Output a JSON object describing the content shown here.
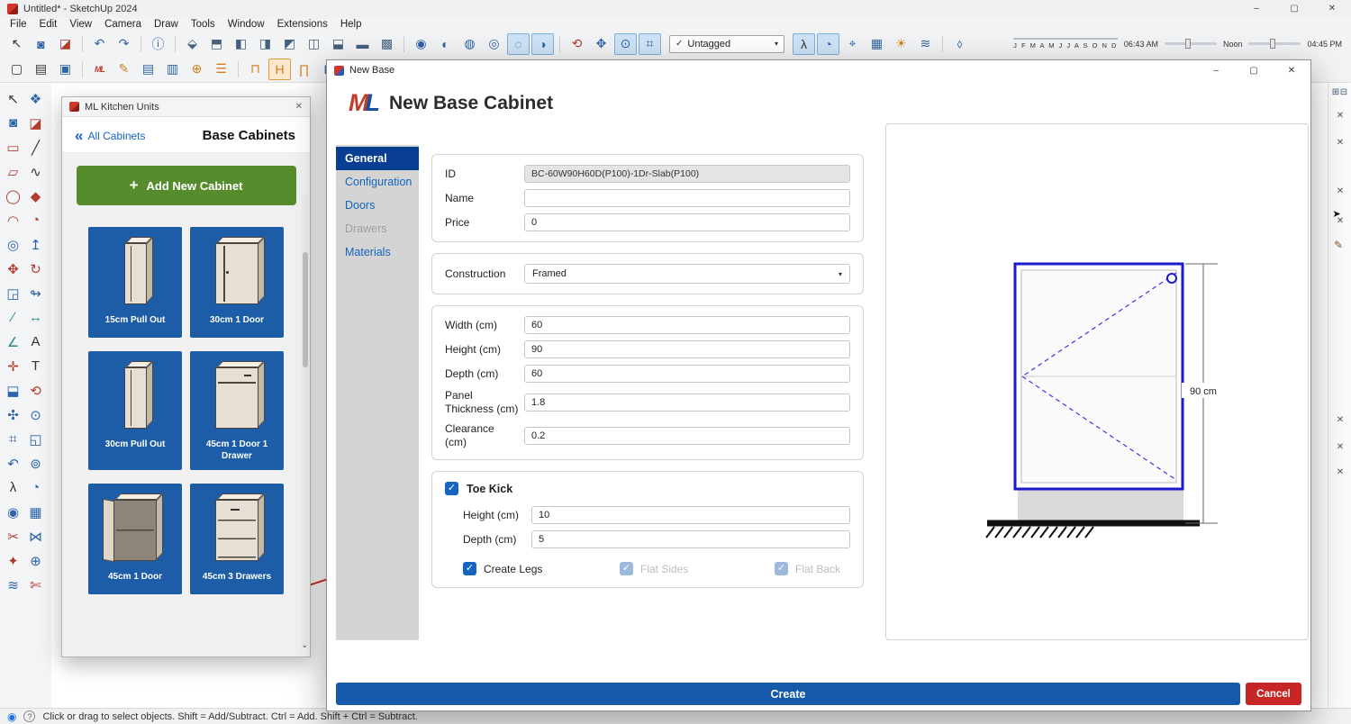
{
  "icons": {
    "close": "✕",
    "minimize": "–",
    "maximize": "▢",
    "caret": "▾",
    "check": "✓",
    "back_chevrons": "«",
    "plus": "+",
    "geo": "◉",
    "help": "?",
    "scroll_down": "⌄",
    "flyout_arrow": "➤",
    "pencil": "✎",
    "tray_expand": "⊞",
    "tray_panels": "⊟"
  },
  "window": {
    "title": "Untitled* - SketchUp 2024"
  },
  "menu": {
    "items": [
      {
        "label": "File",
        "name": "menu-file"
      },
      {
        "label": "Edit",
        "name": "menu-edit"
      },
      {
        "label": "View",
        "name": "menu-view"
      },
      {
        "label": "Camera",
        "name": "menu-camera"
      },
      {
        "label": "Draw",
        "name": "menu-draw"
      },
      {
        "label": "Tools",
        "name": "menu-tools"
      },
      {
        "label": "Window",
        "name": "menu-window"
      },
      {
        "label": "Extensions",
        "name": "menu-extensions"
      },
      {
        "label": "Help",
        "name": "menu-help"
      }
    ]
  },
  "toolbar_top": {
    "row1a": [
      {
        "name": "select-tool-icon",
        "glyph": "↖",
        "cls": "c-dark"
      },
      {
        "name": "paint-bucket-icon",
        "glyph": "◙",
        "cls": "c-blue"
      },
      {
        "name": "eraser-icon",
        "glyph": "◪",
        "cls": "c-red"
      },
      {
        "name": "separator",
        "glyph": "",
        "cls": "sep",
        "inter": "false"
      },
      {
        "name": "undo-icon",
        "glyph": "↶",
        "cls": "c-blue"
      },
      {
        "name": "redo-icon",
        "glyph": "↷",
        "cls": "c-blue"
      },
      {
        "name": "separator",
        "glyph": "",
        "cls": "sep",
        "inter": "false"
      },
      {
        "name": "model-info-icon",
        "glyph": "ⓘ",
        "cls": "c-blue"
      },
      {
        "name": "separator",
        "glyph": "",
        "cls": "sep",
        "inter": "false"
      },
      {
        "name": "iso-view-icon",
        "glyph": "⬙"
      },
      {
        "name": "top-view-icon",
        "glyph": "⬒"
      },
      {
        "name": "front-view-icon",
        "glyph": "◧"
      },
      {
        "name": "right-view-icon",
        "glyph": "◨"
      },
      {
        "name": "back-view-icon",
        "glyph": "◩"
      },
      {
        "name": "left-view-icon",
        "glyph": "◫"
      },
      {
        "name": "section-plane-icon",
        "glyph": "⬓"
      },
      {
        "name": "section-cuts-icon",
        "glyph": "▬"
      },
      {
        "name": "section-fill-icon",
        "glyph": "▩"
      },
      {
        "name": "separator",
        "glyph": "",
        "cls": "sep",
        "inter": "false"
      },
      {
        "name": "outer-shell-icon",
        "glyph": "◉",
        "cls": "c-blue"
      },
      {
        "name": "intersect-icon",
        "glyph": "◐",
        "cls": "c-blue"
      },
      {
        "name": "union-icon",
        "glyph": "◍",
        "cls": "c-blue"
      },
      {
        "name": "subtract-icon",
        "glyph": "◎",
        "cls": "c-blue"
      },
      {
        "name": "trim-icon",
        "glyph": "◌",
        "cls": "c-blue pressed"
      },
      {
        "name": "split-icon",
        "glyph": "◑",
        "cls": "c-blue pressed"
      },
      {
        "name": "separator",
        "glyph": "",
        "cls": "sep",
        "inter": "false"
      },
      {
        "name": "orbit-icon",
        "glyph": "⟲",
        "cls": "c-red"
      },
      {
        "name": "pan-icon",
        "glyph": "✥",
        "cls": "c-blue"
      },
      {
        "name": "zoom-icon",
        "glyph": "⊙",
        "cls": "c-blue pressed"
      },
      {
        "name": "zoom-extents-icon",
        "glyph": "⌗",
        "cls": "c-blue pressed"
      }
    ],
    "tag_filter": {
      "value": "Untagged"
    },
    "row1b": [
      {
        "name": "walk-icon",
        "glyph": "λ",
        "cls": "c-dark pressed"
      },
      {
        "name": "look-around-icon",
        "glyph": "◔",
        "cls": "c-blue pressed"
      },
      {
        "name": "position-camera-icon",
        "glyph": "⌖",
        "cls": "c-blue"
      },
      {
        "name": "match-photo-icon",
        "glyph": "▦",
        "cls": "c-blue"
      },
      {
        "name": "shadows-toggle-icon",
        "glyph": "☀",
        "cls": "c-orange"
      },
      {
        "name": "fog-icon",
        "glyph": "≋",
        "cls": "c-blue"
      },
      {
        "name": "separator",
        "glyph": "",
        "cls": "sep",
        "inter": "false"
      },
      {
        "name": "paint-large-icon",
        "glyph": "⬨",
        "cls": "c-blue"
      }
    ],
    "months": "J F M A M J J A S O N D",
    "time_start": "06:43 AM",
    "time_mid": "Noon",
    "time_end": "04:45 PM",
    "row2": [
      {
        "name": "new-file-icon",
        "glyph": "▢",
        "cls": "c-dark"
      },
      {
        "name": "open-file-icon",
        "glyph": "▤",
        "cls": "c-dark"
      },
      {
        "name": "save-file-icon",
        "glyph": "▣",
        "cls": "c-blue"
      },
      {
        "name": "separator",
        "glyph": "",
        "cls": "sep",
        "inter": "false"
      },
      {
        "name": "ml-kitchen-logo-icon",
        "glyph": "ML",
        "cls": "ml"
      },
      {
        "name": "edit-cabinet-icon",
        "glyph": "✎",
        "cls": "c-orange"
      },
      {
        "name": "cut-list-icon",
        "glyph": "▤",
        "cls": "c-blue"
      },
      {
        "name": "catalog-icon",
        "glyph": "▥",
        "cls": "c-blue"
      },
      {
        "name": "import-cabinet-icon",
        "glyph": "⊕",
        "cls": "c-orange"
      },
      {
        "name": "price-list-icon",
        "glyph": "☰",
        "cls": "c-orange"
      },
      {
        "name": "separator",
        "glyph": "",
        "cls": "sep",
        "inter": "false"
      },
      {
        "name": "wall-units-icon",
        "glyph": "⊓",
        "cls": "c-orange"
      },
      {
        "name": "base-units-icon",
        "glyph": "H",
        "cls": "c-orange pressed-orange"
      },
      {
        "name": "tall-units-icon",
        "glyph": "∏",
        "cls": "c-orange"
      },
      {
        "name": "island-units-icon",
        "glyph": "H",
        "cls": "c-blue"
      },
      {
        "name": "worktop-icon",
        "glyph": "⊞",
        "cls": "c-blue"
      },
      {
        "name": "appliance-icon",
        "glyph": "⊡",
        "cls": "c-blue"
      }
    ]
  },
  "left_toolbar": {
    "items": [
      {
        "name": "select-tool-icon",
        "glyph": "↖",
        "cls": "c-dark"
      },
      {
        "name": "make-component-icon",
        "glyph": "❖",
        "cls": "c-blue"
      },
      {
        "name": "paint-bucket-icon",
        "glyph": "◙",
        "cls": "c-blue"
      },
      {
        "name": "eraser-icon",
        "glyph": "◪",
        "cls": "c-red"
      },
      {
        "name": "rectangle-tool-icon",
        "glyph": "▭",
        "cls": "c-red"
      },
      {
        "name": "line-tool-icon",
        "glyph": "╱",
        "cls": "c-dark"
      },
      {
        "name": "rotated-rectangle-icon",
        "glyph": "▱",
        "cls": "c-red"
      },
      {
        "name": "freehand-tool-icon",
        "glyph": "∿",
        "cls": "c-dark"
      },
      {
        "name": "circle-tool-icon",
        "glyph": "◯",
        "cls": "c-red"
      },
      {
        "name": "polygon-tool-icon",
        "glyph": "◆",
        "cls": "c-red"
      },
      {
        "name": "arc-tool-icon",
        "glyph": "◠",
        "cls": "c-red"
      },
      {
        "name": "pie-tool-icon",
        "glyph": "◔",
        "cls": "c-red"
      },
      {
        "name": "offset-tool-icon",
        "glyph": "◎",
        "cls": "c-blue"
      },
      {
        "name": "push-pull-icon",
        "glyph": "↥",
        "cls": "c-blue"
      },
      {
        "name": "move-tool-icon",
        "glyph": "✥",
        "cls": "c-red"
      },
      {
        "name": "rotate-tool-icon",
        "glyph": "↻",
        "cls": "c-red"
      },
      {
        "name": "scale-tool-icon",
        "glyph": "◲",
        "cls": "c-blue"
      },
      {
        "name": "follow-me-icon",
        "glyph": "↬",
        "cls": "c-blue"
      },
      {
        "name": "tape-measure-icon",
        "glyph": "∕",
        "cls": "c-teal"
      },
      {
        "name": "dimension-tool-icon",
        "glyph": "↔",
        "cls": "c-teal"
      },
      {
        "name": "protractor-icon",
        "glyph": "∠",
        "cls": "c-teal"
      },
      {
        "name": "text-tool-icon",
        "glyph": "A",
        "cls": "c-dark"
      },
      {
        "name": "axes-tool-icon",
        "glyph": "✛",
        "cls": "c-red"
      },
      {
        "name": "3d-text-icon",
        "glyph": "T",
        "cls": "c-dark"
      },
      {
        "name": "section-plane-icon",
        "glyph": "⬓",
        "cls": "c-blue"
      },
      {
        "name": "orbit-icon",
        "glyph": "⟲",
        "cls": "c-red"
      },
      {
        "name": "pan-icon",
        "glyph": "✣",
        "cls": "c-blue"
      },
      {
        "name": "zoom-icon",
        "glyph": "⊙",
        "cls": "c-blue"
      },
      {
        "name": "zoom-window-icon",
        "glyph": "⌗",
        "cls": "c-blue"
      },
      {
        "name": "zoom-extents-icon",
        "glyph": "◱",
        "cls": "c-blue"
      },
      {
        "name": "previous-view-icon",
        "glyph": "↶",
        "cls": "c-blue"
      },
      {
        "name": "position-camera-icon",
        "glyph": "⊚",
        "cls": "c-blue"
      },
      {
        "name": "walk-icon",
        "glyph": "λ",
        "cls": "c-dark"
      },
      {
        "name": "look-around-icon",
        "glyph": "◔",
        "cls": "c-blue"
      },
      {
        "name": "add-location-icon",
        "glyph": "◉",
        "cls": "c-blue"
      },
      {
        "name": "match-photo-icon",
        "glyph": "▦",
        "cls": "c-blue"
      },
      {
        "name": "laser-cut-icon",
        "glyph": "✂",
        "cls": "c-red"
      },
      {
        "name": "weld-icon",
        "glyph": "⋈",
        "cls": "c-blue"
      },
      {
        "name": "spray-icon",
        "glyph": "✦",
        "cls": "c-red"
      },
      {
        "name": "stamp-icon",
        "glyph": "⊕",
        "cls": "c-blue"
      },
      {
        "name": "cloth-icon",
        "glyph": "≋",
        "cls": "c-blue"
      },
      {
        "name": "scissors-icon",
        "glyph": "✄",
        "cls": "c-red"
      }
    ]
  },
  "palette": {
    "title": "ML Kitchen Units",
    "back_link": "All Cabinets",
    "heading": "Base Cabinets",
    "add_button": "Add New Cabinet",
    "cards": [
      {
        "label": "15cm Pull Out",
        "name": "cabinet-card-15cm-pull-out",
        "cls": "variant-pullout"
      },
      {
        "label": "30cm 1 Door",
        "name": "cabinet-card-30cm-1-door",
        "cls": "variant-door"
      },
      {
        "label": "30cm Pull Out",
        "name": "cabinet-card-30cm-pull-out",
        "cls": "variant-pullout"
      },
      {
        "label": "45cm 1 Door 1 Drawer",
        "name": "cabinet-card-45cm-1-door-1-drawer",
        "cls": "variant-door-drawer"
      },
      {
        "label": "45cm 1 Door",
        "name": "cabinet-card-45cm-1-door",
        "cls": "variant-door-open"
      },
      {
        "label": "45cm 3 Drawers",
        "name": "cabinet-card-45cm-3-drawers",
        "cls": "variant-drawers"
      }
    ]
  },
  "dialog": {
    "titlebar": {
      "title": "New Base"
    },
    "logo": {
      "m": "M",
      "l": "L"
    },
    "heading": "New Base Cabinet",
    "nav": [
      {
        "label": "General",
        "name": "tab-general",
        "cls": "active"
      },
      {
        "label": "Configuration",
        "name": "tab-configuration"
      },
      {
        "label": "Doors",
        "name": "tab-doors"
      },
      {
        "label": "Drawers",
        "name": "tab-drawers",
        "cls": "disabled"
      },
      {
        "label": "Materials",
        "name": "tab-materials"
      }
    ],
    "form": {
      "id_label": "ID",
      "id_value": "BC-60W90H60D(P100)-1Dr-Slab(P100)",
      "name_label": "Name",
      "name_value": "",
      "price_label": "Price",
      "price_value": "0",
      "construction_label": "Construction",
      "construction_value": "Framed",
      "width_label": "Width (cm)",
      "width_value": "60",
      "height_label": "Height (cm)",
      "height_value": "90",
      "depth_label": "Depth (cm)",
      "depth_value": "60",
      "panel_label": "Panel Thickness (cm)",
      "panel_value": "1.8",
      "clearance_label": "Clearance (cm)",
      "clearance_value": "0.2",
      "toekick_label": "Toe Kick",
      "tk_height_label": "Height (cm)",
      "tk_height_value": "10",
      "tk_depth_label": "Depth (cm)",
      "tk_depth_value": "5",
      "create_legs_label": "Create Legs",
      "flat_sides_label": "Flat Sides",
      "flat_back_label": "Flat Back"
    },
    "preview": {
      "dimension_label": "90 cm"
    },
    "create_button": "Create",
    "cancel_button": "Cancel"
  },
  "statusbar": {
    "text": "Click or drag to select objects. Shift = Add/Subtract. Ctrl = Add. Shift + Ctrl = Subtract."
  }
}
